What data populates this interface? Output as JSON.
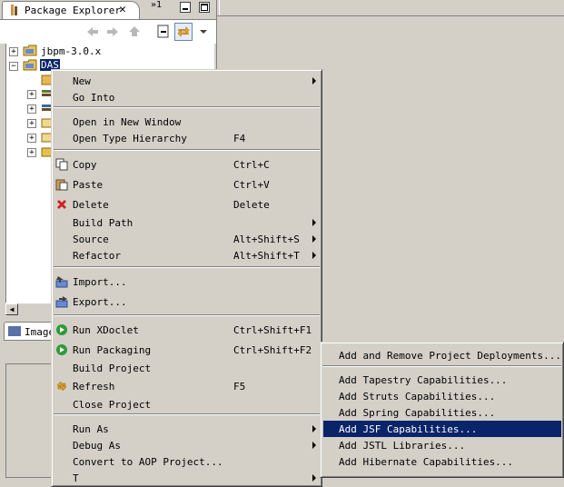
{
  "explorer": {
    "tab_title": "Package Explorer",
    "close_glyph": "✕",
    "overflow": "»1"
  },
  "tree": {
    "items": [
      {
        "label": "jbpm-3.0.x"
      },
      {
        "label": "DAS"
      }
    ]
  },
  "image_view": {
    "tab_label": "Image"
  },
  "context_menu": {
    "groups": [
      [
        {
          "label": "New",
          "submenu": true
        },
        {
          "label": "Go Into"
        }
      ],
      [
        {
          "label": "Open in New Window"
        },
        {
          "label": "Open Type Hierarchy",
          "shortcut": "F4"
        }
      ],
      [
        {
          "label": "Copy",
          "shortcut": "Ctrl+C",
          "icon": "copy-icon"
        },
        {
          "label": "Paste",
          "shortcut": "Ctrl+V",
          "icon": "paste-icon"
        },
        {
          "label": "Delete",
          "shortcut": "Delete",
          "icon": "delete-icon"
        },
        {
          "label": "Build Path",
          "submenu": true
        },
        {
          "label": "Source",
          "shortcut": "Alt+Shift+S",
          "submenu": true
        },
        {
          "label": "Refactor",
          "shortcut": "Alt+Shift+T",
          "submenu": true
        }
      ],
      [
        {
          "label": "Import...",
          "icon": "import-icon"
        },
        {
          "label": "Export...",
          "icon": "export-icon"
        }
      ],
      [
        {
          "label": "Run XDoclet",
          "shortcut": "Ctrl+Shift+F1",
          "icon": "run-icon"
        },
        {
          "label": "Run Packaging",
          "shortcut": "Ctrl+Shift+F2",
          "icon": "run-icon"
        },
        {
          "label": "Build Project"
        },
        {
          "label": "Refresh",
          "shortcut": "F5",
          "icon": "refresh-icon"
        },
        {
          "label": "Close Project"
        }
      ],
      [
        {
          "label": "Run As",
          "submenu": true
        },
        {
          "label": "Debug As",
          "submenu": true
        },
        {
          "label": "Convert to AOP Project..."
        },
        {
          "label": "T",
          "submenu": true
        }
      ]
    ]
  },
  "submenu": {
    "groups": [
      [
        {
          "label": "Add and Remove Project Deployments..."
        }
      ],
      [
        {
          "label": "Add Tapestry Capabilities..."
        },
        {
          "label": "Add Struts Capabilities..."
        },
        {
          "label": "Add Spring Capabilities..."
        },
        {
          "label": "Add JSF Capabilities...",
          "highlighted": true
        },
        {
          "label": "Add JSTL Libraries..."
        },
        {
          "label": "Add Hibernate Capabilities..."
        }
      ]
    ]
  },
  "colors": {
    "selection": "#0a246a",
    "face": "#d4d0c8",
    "delete": "#d42020",
    "run": "#2e9a3a"
  }
}
